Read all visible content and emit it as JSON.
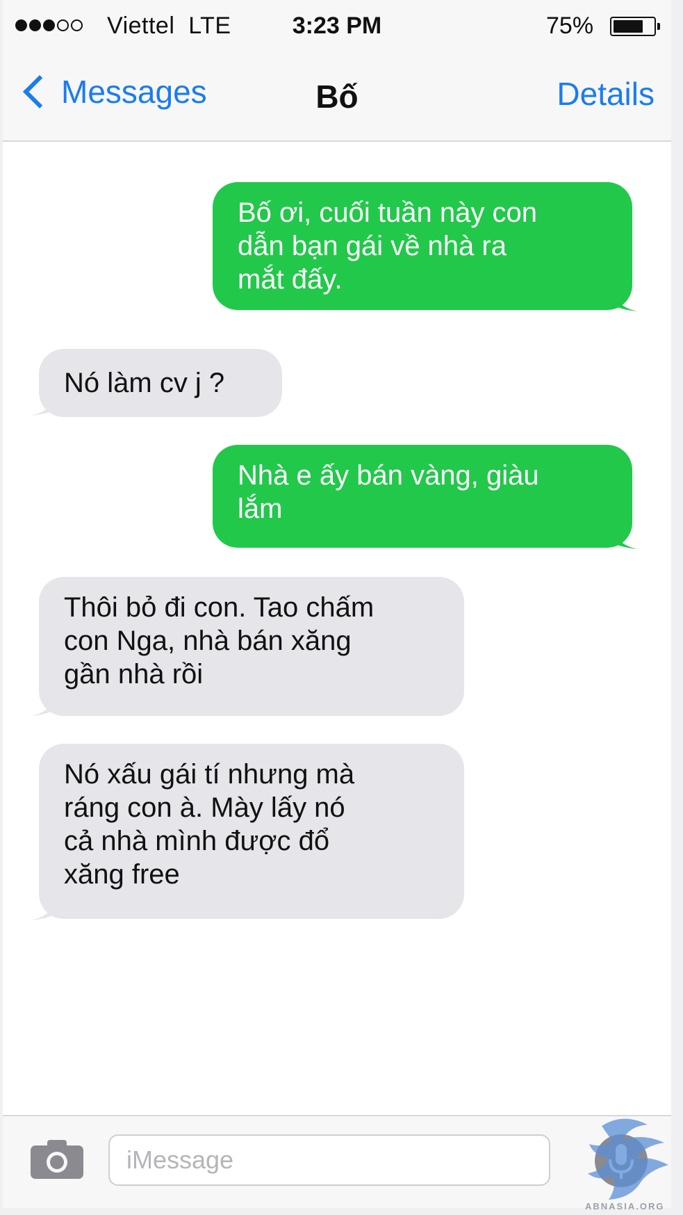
{
  "status_bar": {
    "carrier": "Viettel  LTE",
    "time": "3:23 PM",
    "battery_percent": "75%",
    "battery_level": 0.75,
    "signal_bars_filled": 3,
    "signal_bars_total": 5
  },
  "nav": {
    "back_label": "Messages",
    "title": "Bố",
    "details_label": "Details"
  },
  "messages": [
    {
      "direction": "outgoing",
      "text": "Bố ơi, cuối tuần này con\ndẫn bạn gái về nhà ra\nmắt đấy."
    },
    {
      "direction": "incoming",
      "text": "Nó làm cv j ?"
    },
    {
      "direction": "outgoing",
      "text": "Nhà e ấy bán vàng, giàu\nlắm"
    },
    {
      "direction": "incoming",
      "text": "Thôi bỏ đi con. Tao chấm\ncon Nga, nhà bán xăng\ngần nhà rồi"
    },
    {
      "direction": "incoming",
      "text": "Nó xấu gái tí nhưng mà\nráng con à. Mày lấy nó\ncả nhà mình được đổ\nxăng free"
    }
  ],
  "input": {
    "placeholder": "iMessage"
  },
  "icons": {
    "camera": "camera-icon",
    "mic": "microphone-icon",
    "back": "chevron-left-icon"
  },
  "colors": {
    "outgoing_bubble": "#22c84a",
    "incoming_bubble": "#e5e5ea",
    "accent": "#1a7cf0"
  },
  "watermark": "ABNASIA.ORG"
}
